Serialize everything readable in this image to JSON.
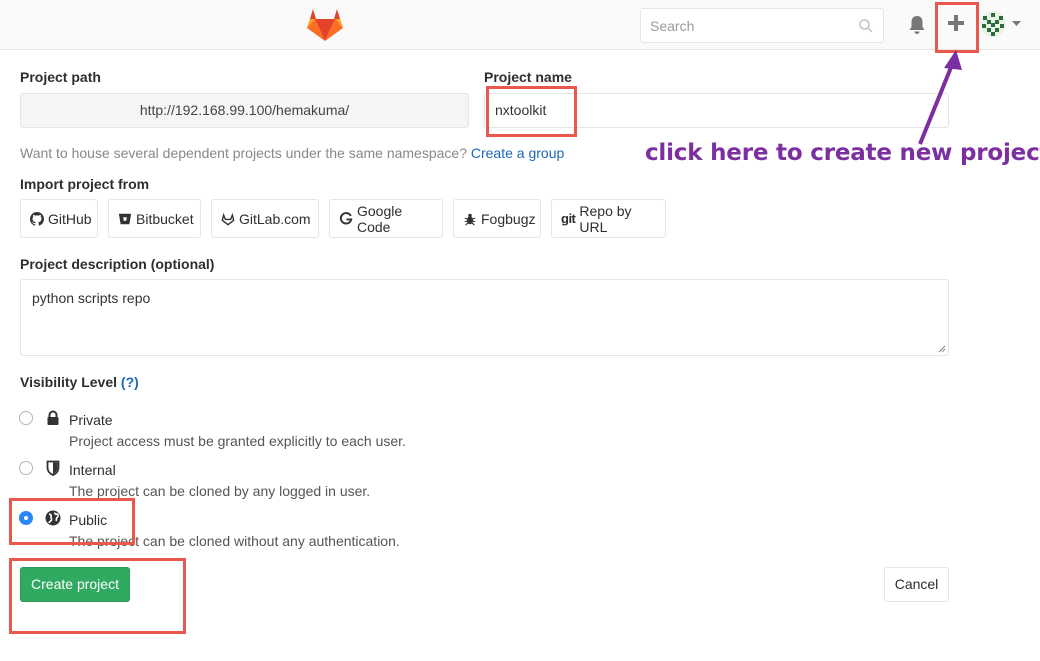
{
  "header": {
    "search_placeholder": "Search",
    "icons": [
      "gitlab-logo",
      "search-icon",
      "bell-icon",
      "plus-icon",
      "avatar",
      "caret-down-icon"
    ]
  },
  "form": {
    "project_path_label": "Project path",
    "project_path_value": "http://192.168.99.100/hemakuma/",
    "project_name_label": "Project name",
    "project_name_value": "nxtoolkit",
    "namespace_help": "Want to house several dependent projects under the same namespace?",
    "create_group_link": "Create a group",
    "import_label": "Import project from",
    "import_sources": [
      {
        "label": "GitHub",
        "icon": "github-icon"
      },
      {
        "label": "Bitbucket",
        "icon": "bitbucket-icon"
      },
      {
        "label": "GitLab.com",
        "icon": "gitlab-icon"
      },
      {
        "label": "Google Code",
        "icon": "google-icon"
      },
      {
        "label": "Fogbugz",
        "icon": "bug-icon"
      },
      {
        "label": "Repo by URL",
        "icon": "git-icon",
        "prefix": "git"
      }
    ],
    "description_label": "Project description (optional)",
    "description_value": "python scripts repo",
    "visibility_label": "Visibility Level",
    "visibility_help": "(?)",
    "visibility_options": [
      {
        "name": "Private",
        "description": "Project access must be granted explicitly to each user.",
        "icon": "lock-icon",
        "selected": false
      },
      {
        "name": "Internal",
        "description": "The project can be cloned by any logged in user.",
        "icon": "shield-icon",
        "selected": false
      },
      {
        "name": "Public",
        "description": "The project can be cloned without any authentication.",
        "icon": "globe-icon",
        "selected": true
      }
    ],
    "create_button": "Create project",
    "cancel_button": "Cancel"
  },
  "annotation": {
    "text": "click here to create new project",
    "color": "#7b2fa0",
    "highlight_color": "#e8584c"
  },
  "colors": {
    "primary_green": "#2faa60",
    "link_blue": "#1b69b6",
    "radio_blue": "#2a86f5"
  }
}
